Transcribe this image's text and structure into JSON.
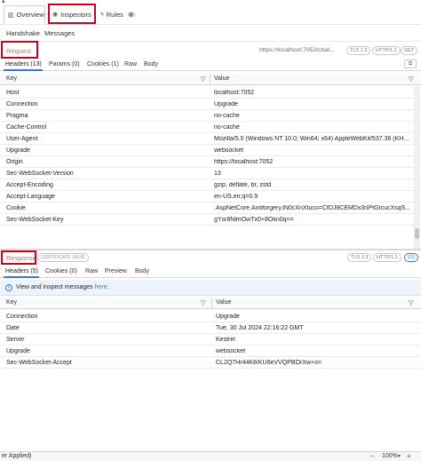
{
  "tabs": {
    "overview": "Overview",
    "inspectors": "Inspectors",
    "rules": "Rules"
  },
  "subtabs": {
    "handshake": "Handshake",
    "messages": "Messages"
  },
  "request": {
    "label": "Request",
    "url": "https://localhost:7052/chat...",
    "tls": "TLS 1.3",
    "http": "HTTP/1.1",
    "method": "GET",
    "detail_tabs": [
      "Headers (13)",
      "Params (0)",
      "Cookies (1)",
      "Raw",
      "Body"
    ],
    "columns": {
      "key": "Key",
      "value": "Value"
    },
    "rows": [
      {
        "key": "Host",
        "value": "localhost:7052"
      },
      {
        "key": "Connection",
        "value": "Upgrade"
      },
      {
        "key": "Pragma",
        "value": "no-cache"
      },
      {
        "key": "Cache-Control",
        "value": "no-cache"
      },
      {
        "key": "User-Agent",
        "value": "Mozilla/5.0 (Windows NT 10.0; Win64; x64) AppleWebKit/537.36 (KH..."
      },
      {
        "key": "Upgrade",
        "value": "websocket"
      },
      {
        "key": "Origin",
        "value": "https://localhost:7052"
      },
      {
        "key": "Sec-WebSocket-Version",
        "value": "13"
      },
      {
        "key": "Accept-Encoding",
        "value": "gzip, deflate, br, zstd"
      },
      {
        "key": "Accept-Language",
        "value": "en-US,en;q=0.9"
      },
      {
        "key": "Cookie",
        "value": ".AspNetCore.Antiforgery.lN0cXnXtuco=CfDJ8CEMDx3rIPtGtcucXsqS..."
      },
      {
        "key": "Sec-WebSocket-Key",
        "value": "gYsr8NlmOwTx0+8Okn0q=="
      }
    ]
  },
  "response": {
    "label": "Response",
    "cert": "CERTIFICATE VALID",
    "tls": "TLS 1.3",
    "http": "HTTP/1.1",
    "status": "101",
    "detail_tabs": [
      "Headers (5)",
      "Cookies (0)",
      "Raw",
      "Preview",
      "Body"
    ],
    "info_text": "View and inspect messages ",
    "info_link": "here",
    "info_end": ".",
    "columns": {
      "key": "Key",
      "value": "Value"
    },
    "rows": [
      {
        "key": "Connection",
        "value": "Upgrade"
      },
      {
        "key": "Date",
        "value": "Tue, 30 Jul 2024 22:16:22 GMT"
      },
      {
        "key": "Server",
        "value": "Kestrel"
      },
      {
        "key": "Upgrade",
        "value": "websocket"
      },
      {
        "key": "Sec-WebSocket-Accept",
        "value": "CL2Q7Hr44K8/KU6eVVQPBOrXw+o="
      }
    ]
  },
  "statusbar": {
    "left": "er Applied)",
    "zoom": "100%",
    "minus": "−",
    "plus": "+"
  }
}
